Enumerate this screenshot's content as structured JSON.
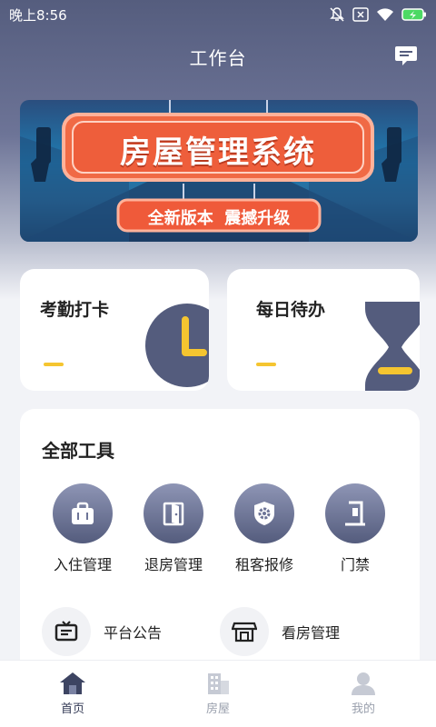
{
  "status_bar": {
    "time": "晚上8:56",
    "icons": [
      "bell-off-icon",
      "sim-close-icon",
      "wifi-icon",
      "battery-charging-icon"
    ]
  },
  "header": {
    "title": "工作台",
    "message_icon": "message-icon"
  },
  "banner": {
    "title": "房屋管理系统",
    "subtitle": "全新版本  震撼升级"
  },
  "cards": [
    {
      "label": "考勤打卡",
      "icon": "clock-icon"
    },
    {
      "label": "每日待办",
      "icon": "hourglass-icon"
    }
  ],
  "tools": {
    "title": "全部工具",
    "items": [
      {
        "label": "入住管理",
        "icon": "suitcase-icon"
      },
      {
        "label": "退房管理",
        "icon": "door-icon"
      },
      {
        "label": "租客报修",
        "icon": "shield-gear-icon"
      },
      {
        "label": "门禁",
        "icon": "gate-icon"
      }
    ],
    "links": [
      {
        "label": "平台公告",
        "icon": "announcement-icon"
      },
      {
        "label": "看房管理",
        "icon": "store-icon"
      }
    ]
  },
  "tabbar": {
    "items": [
      {
        "label": "首页",
        "icon": "home-icon",
        "active": true
      },
      {
        "label": "房屋",
        "icon": "building-icon",
        "active": false
      },
      {
        "label": "我的",
        "icon": "user-icon",
        "active": false
      }
    ]
  },
  "colors": {
    "header_top": "#555d7e",
    "icon_dark": "#545c7d",
    "accent_yellow": "#f5c530",
    "banner_orange": "#f06a45"
  }
}
